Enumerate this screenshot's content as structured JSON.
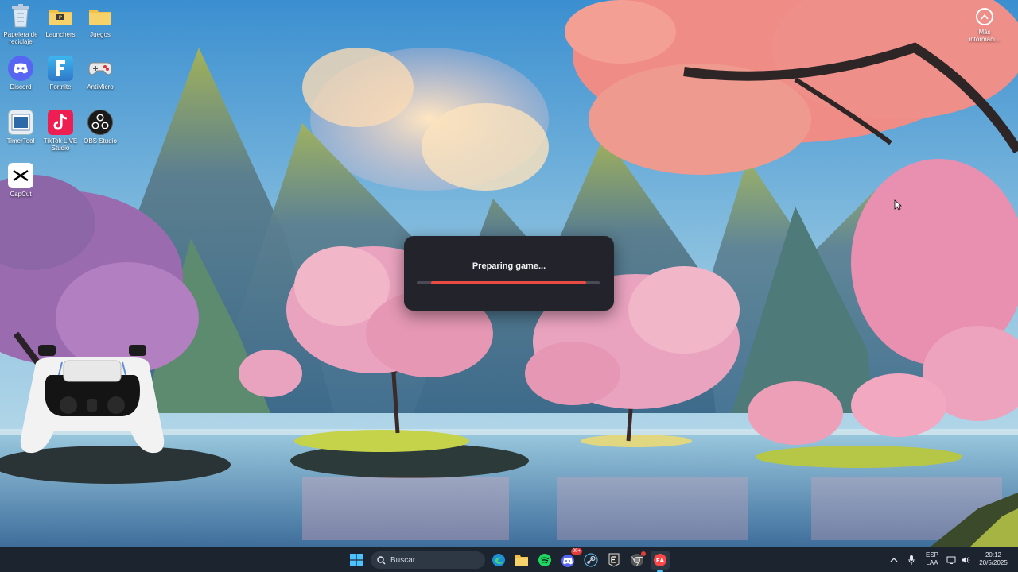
{
  "desktop": {
    "icons": [
      {
        "label": "Papelera de reciclaje",
        "icon": "recycle-bin-icon"
      },
      {
        "label": "Launchers",
        "icon": "folder-icon"
      },
      {
        "label": "Juegos",
        "icon": "folder-icon"
      },
      {
        "label": "Discord",
        "icon": "discord-icon"
      },
      {
        "label": "Fortnite",
        "icon": "fortnite-icon"
      },
      {
        "label": "AntiMicro",
        "icon": "gamepad-icon"
      },
      {
        "label": "TimerTool",
        "icon": "timer-icon"
      },
      {
        "label": "TikTok LIVE Studio",
        "icon": "tiktok-icon"
      },
      {
        "label": "OBS Studio",
        "icon": "obs-icon"
      },
      {
        "label": "CapCut",
        "icon": "capcut-icon"
      }
    ],
    "info_corner_label": "Más informaci..."
  },
  "dialog": {
    "title": "Preparing game...",
    "progress": 0.92
  },
  "taskbar": {
    "search_placeholder": "Buscar",
    "language_line1": "ESP",
    "language_line2": "LAA",
    "time": "20:12",
    "date": "20/5/2025",
    "apps": [
      "start-icon",
      "search-icon",
      "edge-icon",
      "file-explorer-icon",
      "spotify-icon",
      "discord-icon",
      "steam-icon",
      "epic-games-icon",
      "chrome-icon",
      "ea-app-icon"
    ],
    "discord_badge": "99+"
  },
  "colors": {
    "accent": "#ea4b45",
    "dialog_bg": "#23232b",
    "taskbar_bg": "#1c2430"
  }
}
